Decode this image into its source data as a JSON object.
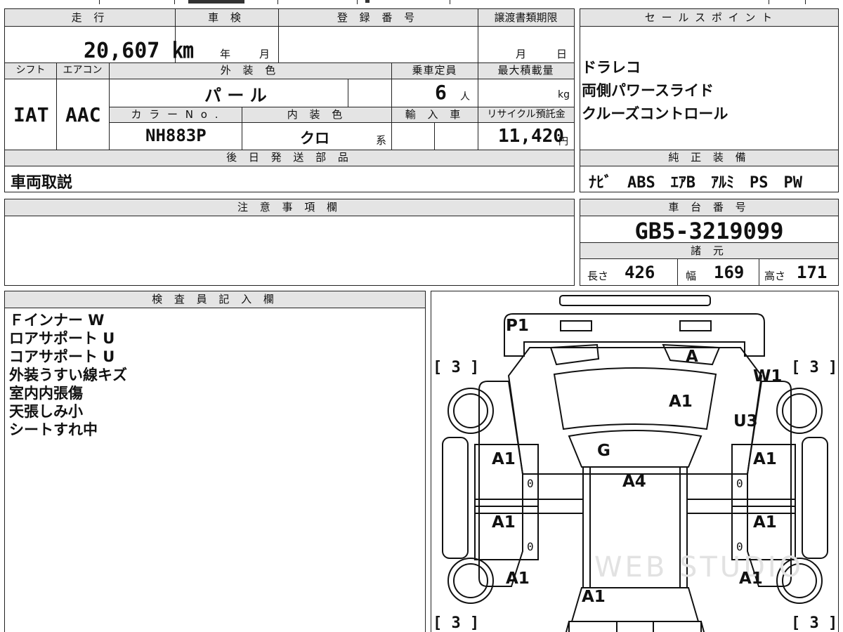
{
  "top_labels": {
    "mileage": "走 行",
    "inspection": "車 検",
    "registration": "登 録 番 号",
    "transfer_deadline": "譲渡書類期限",
    "sales_points": "セ ー ル ス ポ イ ン ト",
    "shift": "シフト",
    "aircon": "エアコン",
    "exterior_color": "外 装 色",
    "capacity": "乗車定員",
    "max_load": "最大積載量",
    "color_no": "カ ラ ー N o .",
    "interior_color": "内 装 色",
    "import": "輸 入 車",
    "recycle": "リサイクル預託金",
    "later_parts": "後 日 発 送 部 品",
    "genuine_equipment": "純 正 装 備",
    "notes": "注 意 事 項 欄",
    "chassis_no": "車 台 番 号",
    "specs": "諸 元",
    "inspector": "検 査 員 記 入 欄"
  },
  "values": {
    "mileage": "20,607 ㎞",
    "inspection_year": "年",
    "inspection_month": "月",
    "transfer_month": "月",
    "transfer_day": "日",
    "shift": "IAT",
    "aircon": "AAC",
    "exterior_color": "パ ー ル",
    "capacity": "6",
    "capacity_unit": "人",
    "max_load_unit": "kg",
    "color_no": "NH883P",
    "interior_color": "クロ",
    "interior_suffix": "系",
    "recycle": "11,420",
    "recycle_unit": "円",
    "later_parts": "車両取説",
    "chassis_no": "GB5-3219099",
    "length_label": "長さ",
    "length": "426",
    "width_label": "幅",
    "width": "169",
    "height_label": "高さ",
    "height": "171"
  },
  "sales_points": [
    "ドラレコ",
    "両側パワースライド",
    "クルーズコントロール"
  ],
  "genuine_equipment": "ﾅﾋﾞ　ABS　ｴｱB　ｱﾙﾐ　PS　PW",
  "inspector_notes": [
    "Ｆインナー W",
    "ロアサポート U",
    "コアサポート U",
    "外装うすい線キズ",
    "室内内張傷",
    "天張しみ小",
    "シートすれ中"
  ],
  "diagram": {
    "marks": {
      "front_bumper": "P1",
      "windshield_corner": "A",
      "front_right": "W1",
      "hood": "A1",
      "front_right_fender": "U3",
      "roof_front": "G",
      "roof": "A4",
      "front_left_door": "A1",
      "front_right_door": "A1",
      "rear_left_door": "A1",
      "rear_right_door": "A1",
      "rear_left_quarter": "A1",
      "rear_right_quarter": "A1",
      "back_door": "A1"
    },
    "zeros": [
      "0",
      "0",
      "0",
      "0"
    ],
    "tires": [
      "[ 3 ]",
      "[ 3 ]",
      "[ 3 ]",
      "[ 3 ]"
    ],
    "watermark": "WEB STUDIO"
  }
}
